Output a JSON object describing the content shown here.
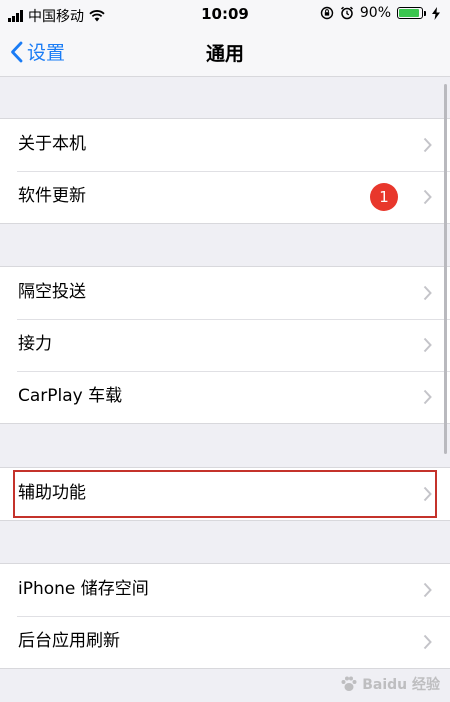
{
  "status_bar": {
    "carrier": "中国移动",
    "time": "10:09",
    "battery_percent": "90%",
    "battery_level": 0.9,
    "icons": [
      "signal-icon",
      "wifi-icon",
      "rotation-lock-icon",
      "alarm-icon",
      "battery-icon",
      "charging-icon"
    ]
  },
  "nav": {
    "back_label": "设置",
    "title": "通用"
  },
  "groups": [
    {
      "items": [
        {
          "label": "关于本机"
        },
        {
          "label": "软件更新",
          "badge": "1"
        }
      ]
    },
    {
      "items": [
        {
          "label": "隔空投送"
        },
        {
          "label": "接力"
        },
        {
          "label": "CarPlay 车载"
        }
      ]
    },
    {
      "items": [
        {
          "label": "辅助功能",
          "highlighted": true
        }
      ]
    },
    {
      "items": [
        {
          "label": "iPhone 储存空间"
        },
        {
          "label": "后台应用刷新"
        }
      ]
    }
  ],
  "colors": {
    "accent": "#1a7cf5",
    "badge": "#e8372c",
    "highlight_border": "#c4322b",
    "background": "#efeff4"
  },
  "watermark": {
    "text": "Baidu 经验"
  }
}
